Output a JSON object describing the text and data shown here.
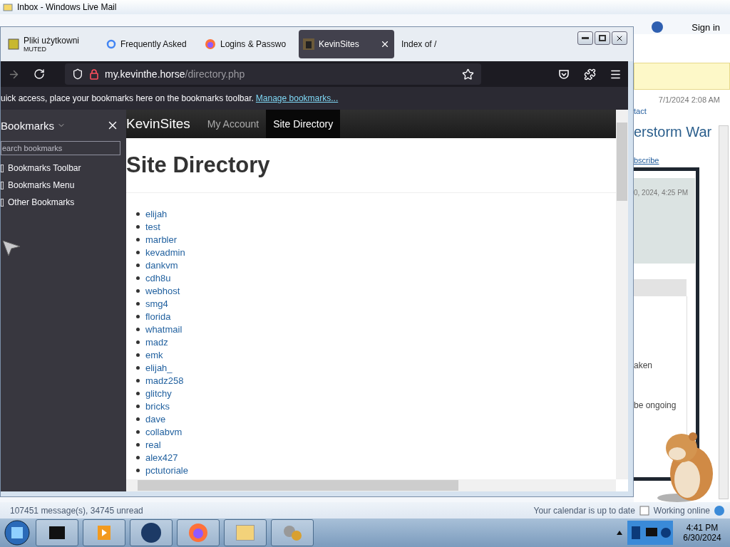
{
  "mail_window": {
    "title": "Inbox - Windows Live Mail",
    "sign_in": "Sign in",
    "reading_pane": {
      "date": "7/1/2024 2:08 AM",
      "contact_link": "tact",
      "subject": "erstorm War",
      "subscribe_link": "bscribe",
      "card_date": "0, 2024, 4:25 PM",
      "lines": [
        "aken",
        "be ongoing"
      ]
    },
    "status_bar": {
      "messages": "107451 message(s), 34745 unread",
      "calendar": "Your calendar is up to date",
      "online": "Working online"
    }
  },
  "browser": {
    "tabs": [
      {
        "title": "Pliki użytkowni",
        "subtitle": "MUTED",
        "kind": "app",
        "selected": false
      },
      {
        "title": "Frequently Asked",
        "kind": "google",
        "selected": false
      },
      {
        "title": "Logins & Passwo",
        "kind": "firefox",
        "selected": false
      },
      {
        "title": "KevinSites",
        "kind": "site",
        "selected": true
      },
      {
        "title": "Index of /",
        "kind": "blank",
        "selected": false
      }
    ],
    "url_host": "my.kevinthe.horse",
    "url_path": "/directory.php",
    "bookmarks_bar": {
      "text": "uick access, place your bookmarks here on the bookmarks toolbar.",
      "link": "Manage bookmarks..."
    },
    "sidebar": {
      "title": "Bookmarks",
      "search_placeholder": "earch bookmarks",
      "items": [
        "Bookmarks Toolbar",
        "Bookmarks Menu",
        "Other Bookmarks"
      ]
    },
    "page": {
      "brand": "KevinSites",
      "nav": [
        {
          "label": "My Account",
          "selected": false
        },
        {
          "label": "Site Directory",
          "selected": true
        }
      ],
      "heading": "Site Directory",
      "links": [
        "elijah",
        "test",
        "marbler",
        "kevadmin",
        "dankvm",
        "cdh8u",
        "webhost",
        "smg4",
        "florida",
        "whatmail",
        "madz",
        "emk",
        "elijah_",
        "madz258",
        "glitchy",
        "bricks",
        "dave",
        "collabvm",
        "real",
        "alex427",
        "pctutoriale"
      ]
    }
  },
  "taskbar": {
    "clock_time": "4:41 PM",
    "clock_date": "6/30/2024"
  }
}
